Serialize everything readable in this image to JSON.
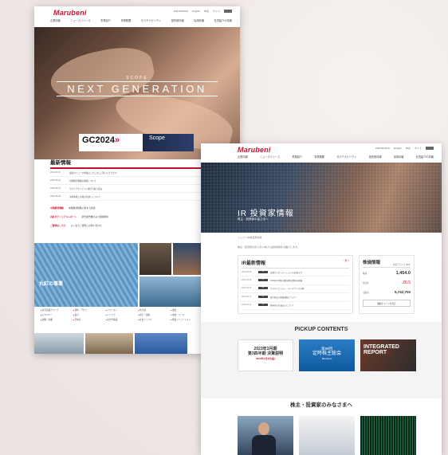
{
  "brand": {
    "logo_text": "Marubeni",
    "accent": "#c8102e"
  },
  "screen1": {
    "header": {
      "utility": [
        "JOB  PEOPLE",
        "English",
        "中文",
        "サイト"
      ],
      "nav": [
        "企業情報",
        "ニュースリリース",
        "事業紹介",
        "事業概要",
        "サステナビリティ",
        "投資家情報",
        "採用情報",
        "社員紹介の情報"
      ]
    },
    "hero": {
      "small": "SCOPE",
      "title": "NEXT GENERATION"
    },
    "banners": {
      "gc": "GC2024",
      "scope": "Scope"
    },
    "news": {
      "title": "最新情報",
      "rows": [
        {
          "date": "2024.09.01",
          "text": "最新のニュース内容はこちらからご覧いただけます"
        },
        {
          "date": "2024.08.26",
          "text": "中期経営戦略の概要について"
        },
        {
          "date": "2024.08.20",
          "text": "サステナビリティに関する取り組み"
        },
        {
          "date": "2024.08.09",
          "text": "決算情報と今後の見通しについて"
        }
      ]
    },
    "links": [
      {
        "label": "中期経営戦略",
        "text": "中期経営戦略に関する情報"
      },
      {
        "label": "丸紅のアニュアルレポート",
        "text": "統合報告書および関連資料"
      },
      {
        "label": "ご質問はこちら",
        "text": "よくあるご質問とお問い合わせ"
      }
    ],
    "tile_tagline": "丸紅の事業",
    "link_grid": [
      "生活産業グループ",
      "食料・アグリ",
      "フォレスト",
      "化学品",
      "金属",
      "エネルギー",
      "電力",
      "インフラ",
      "航空・船舶",
      "金融・リース",
      "建機・産機",
      "不動産",
      "次世代事業",
      "社会インフラ",
      "情報ソリューション"
    ]
  },
  "screen2": {
    "header": {
      "utility": [
        "JOB  PEOPLE",
        "English",
        "中文",
        "サイト"
      ],
      "nav": [
        "企業情報",
        "ニュースリリース",
        "事業紹介",
        "事業概要",
        "サステナビリティ",
        "投資家情報",
        "採用情報",
        "社員紹介の情報"
      ]
    },
    "hero": {
      "title": "IR 投資家情報",
      "sub": "株主・投資家の皆さまへ"
    },
    "breadcrumb": "トップ  >  IR投資家情報",
    "notice": "株主・投資家の皆さまに向けた最新情報をお届けします。",
    "news": {
      "title": "IR最新情報",
      "more": "一覧へ",
      "rows": [
        {
          "date": "2023.05.01",
          "tag": "IR",
          "text": "決算プレゼンテーションのお知らせ"
        },
        {
          "date": "2023.04.28",
          "tag": "IR",
          "text": "2023年3月期 決算説明会資料を掲載"
        },
        {
          "date": "2023.04.20",
          "tag": "IR",
          "text": "サステナビリティ・データブック公開"
        },
        {
          "date": "2023.04.10",
          "tag": "IR",
          "text": "株主総会の招集通知について"
        },
        {
          "date": "2023.03.31",
          "tag": "IR",
          "text": "配当金のお支払いについて"
        }
      ]
    },
    "stock": {
      "title": "株価情報",
      "code": "東証プライム 8002",
      "price_label": "株価",
      "price": "1,454.0",
      "change_label": "前日比",
      "change": "-20.5",
      "volume_label": "出来高",
      "volume": "5,742,700",
      "button": "株価チャートを見る"
    },
    "pickup": {
      "title": "PICKUP CONTENTS",
      "item1": {
        "line1": "2023年3月期",
        "line2": "第3四半期 決算説明",
        "line3": "2023年2月3日(金)"
      },
      "item2": {
        "line1": "第99回",
        "line2": "定時株主総会",
        "line3": "Marubeni"
      },
      "item3": {
        "line1": "INTEGRATED",
        "line2": "REPORT"
      }
    },
    "share_title": "株主・投資家のみなさまへ"
  }
}
